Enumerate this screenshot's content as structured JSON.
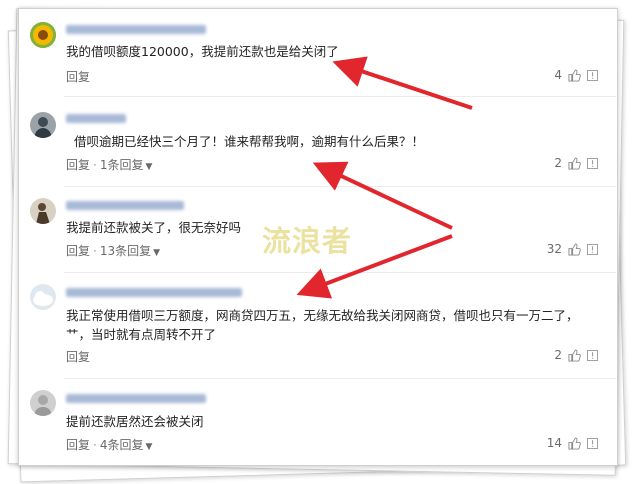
{
  "watermark": "流浪者",
  "icons": {
    "like": "thumbs-up-icon",
    "report": "report-icon",
    "expand": "chevron-down-icon"
  },
  "colors": {
    "annotation_arrow": "#e2262d",
    "watermark": "#e9df96",
    "text": "#222222",
    "meta": "#6a6a6a"
  },
  "comments": [
    {
      "text": "我的借呗额度120000，我提前还款也是给关闭了",
      "reply_label": "回复",
      "more_replies": "",
      "likes": "4",
      "avatar": "sunflower-avatar"
    },
    {
      "text": "借呗逾期已经快三个月了！谁来帮帮我啊，逾期有什么后果？！",
      "reply_label": "回复",
      "more_replies": "1条回复",
      "likes": "2",
      "avatar": "portrait-avatar"
    },
    {
      "text": "我提前还款被关了，很无奈好吗",
      "reply_label": "回复",
      "more_replies": "13条回复",
      "likes": "32",
      "avatar": "figure-avatar"
    },
    {
      "text": "我正常使用借呗三万额度，网商贷四万五，无缘无故给我关闭网商贷，借呗也只有一万二了，艹，当时就有点周转不开了",
      "reply_label": "回复",
      "more_replies": "",
      "likes": "2",
      "avatar": "cloud-avatar"
    },
    {
      "text": "提前还款居然还会被关闭",
      "reply_label": "回复",
      "more_replies": "4条回复",
      "likes": "14",
      "avatar": "grey-avatar"
    }
  ]
}
